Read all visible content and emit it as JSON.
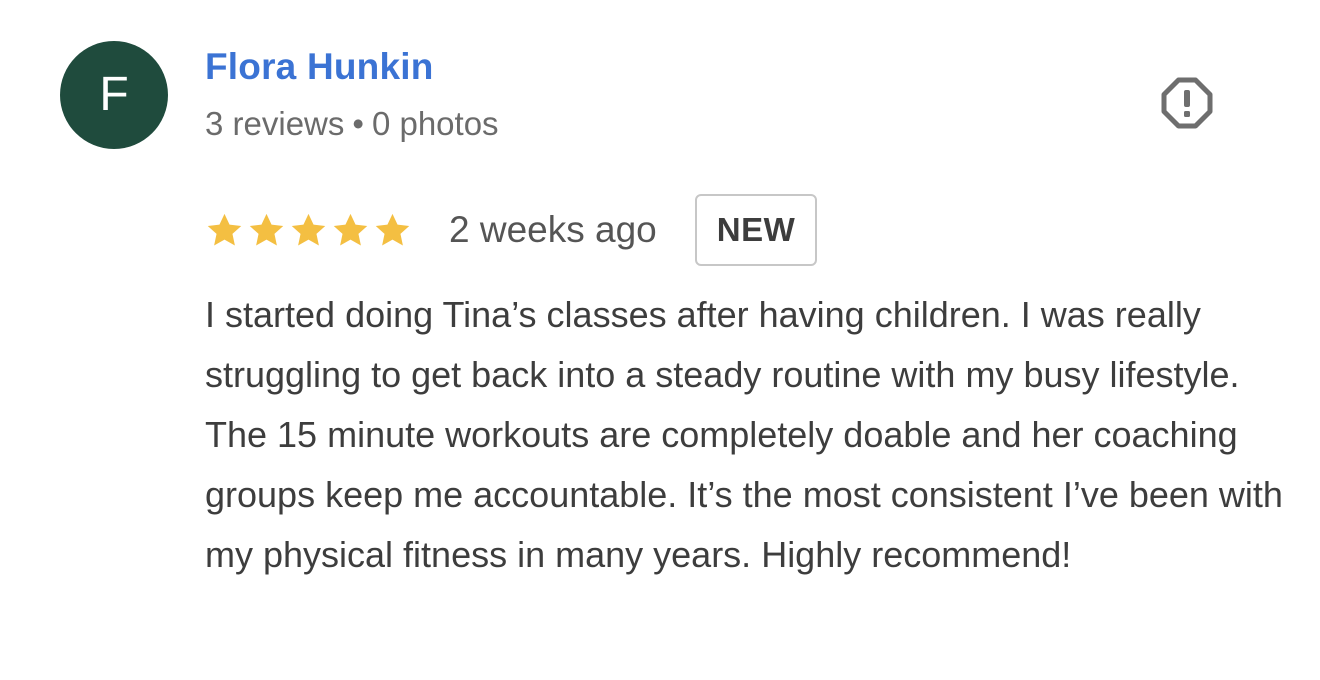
{
  "reviewer": {
    "avatar_letter": "F",
    "avatar_color": "#1f4b3d",
    "name": "Flora Hunkin",
    "name_color": "#3b73d4",
    "reviews": "3 reviews",
    "separator": "•",
    "photos": "0 photos"
  },
  "report": {
    "icon": "report-flag-icon"
  },
  "rating": {
    "stars": 5,
    "max_stars": 5,
    "star_color": "#f4bf42",
    "time_ago": "2 weeks ago",
    "badge": "NEW"
  },
  "review": {
    "text": "I started doing Tina’s classes after having children. I was really struggling to get back into a steady routine with my busy lifestyle. The 15 minute workouts are completely doable and her coaching groups keep me accountable. It’s the most consistent I’ve been with my physical fitness in many years. Highly recommend!"
  }
}
